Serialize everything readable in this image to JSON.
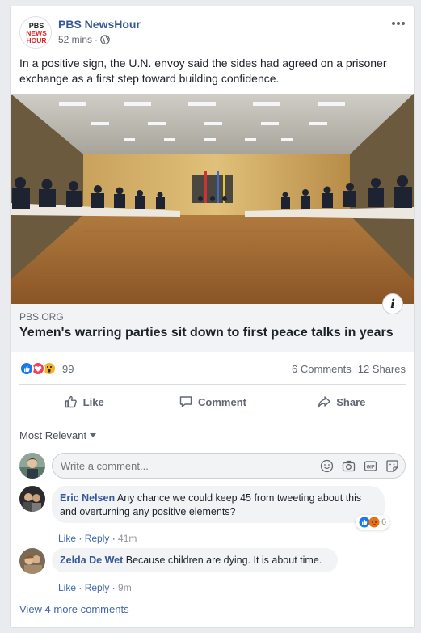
{
  "post": {
    "page_name": "PBS NewsHour",
    "logo_lines": [
      "PBS",
      "NEWS",
      "HOUR"
    ],
    "time": "52 mins",
    "text": "In a positive sign, the U.N. envoy said the sides had agreed on a prisoner exchange as a first step toward building confidence.",
    "link_domain": "PBS.ORG",
    "link_title": "Yemen's warring parties sit down to first peace talks in years"
  },
  "stats": {
    "reaction_count": "99",
    "comments": "6 Comments",
    "shares": "12 Shares"
  },
  "actions": {
    "like": "Like",
    "comment": "Comment",
    "share": "Share"
  },
  "comments_section": {
    "sort_label": "Most Relevant",
    "placeholder": "Write a comment...",
    "items": [
      {
        "author": "Eric Nelsen",
        "text_line1": "Any chance we could keep 45 from tweeting about this",
        "text_line2": "and overturning any positive elements?",
        "like": "Like",
        "reply": "Reply",
        "time": "41m",
        "reaction_count": "6"
      },
      {
        "author": "Zelda De Wet",
        "text": "Because children are dying. It is about time.",
        "like": "Like",
        "reply": "Reply",
        "time": "9m"
      }
    ],
    "view_more": "View 4 more comments"
  },
  "colors": {
    "link_blue": "#365899",
    "like_blue": "#1877f2",
    "love_red": "#f33e58",
    "wow_yellow": "#f7b125",
    "angry_orange": "#e9710f"
  },
  "icons": [
    "globe-icon",
    "more-icon",
    "info-icon",
    "like-icon",
    "comment-icon",
    "share-icon",
    "dropdown-arrow-icon",
    "emoji-icon",
    "camera-icon",
    "gif-icon",
    "sticker-icon"
  ]
}
